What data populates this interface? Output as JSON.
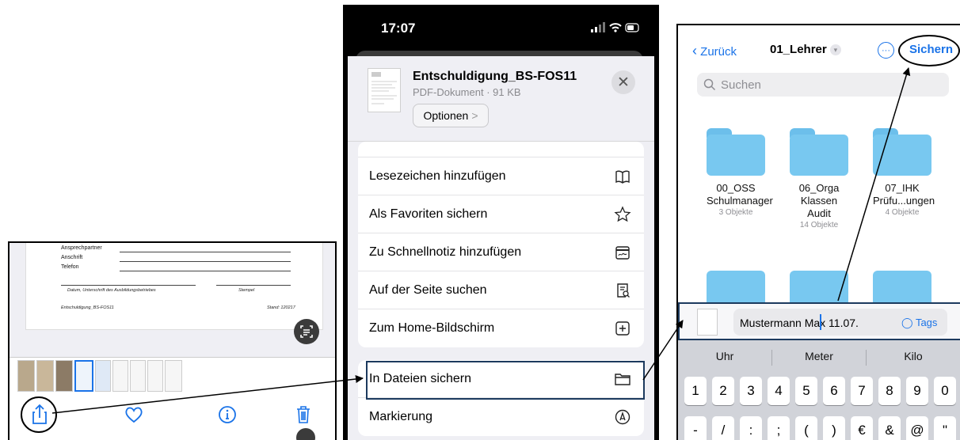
{
  "photos_panel": {
    "doc_labels": [
      "Ansprechpartner",
      "Anschrift",
      "Telefon"
    ],
    "doc_sign_caption": "Datum, Unterschrift des Ausbildungsbetriebes",
    "doc_stamp_caption": "Stempel",
    "doc_footer_left": "Entschuldigung_BS-FOS11",
    "doc_footer_right": "Stand: 120217",
    "toolbar": [
      "share-icon",
      "heart-icon",
      "info-icon",
      "trash-icon"
    ],
    "accent_color": "#1a73e8"
  },
  "share_sheet": {
    "time": "17:07",
    "file_name": "Entschuldigung_BS-FOS11",
    "file_meta": "PDF-Dokument · 91 KB",
    "options_label": "Optionen",
    "options_chevron": ">",
    "close_glyph": "✕",
    "actions_group1": [
      {
        "label": "Lesezeichen hinzufügen",
        "icon": "book-icon"
      },
      {
        "label": "Als Favoriten sichern",
        "icon": "star-icon"
      },
      {
        "label": "Zu Schnellnotiz hinzufügen",
        "icon": "quicknote-icon"
      },
      {
        "label": "Auf der Seite suchen",
        "icon": "find-on-page-icon"
      },
      {
        "label": "Zum Home-Bildschirm",
        "icon": "add-square-icon"
      }
    ],
    "actions_group2": [
      {
        "label": "In Dateien sichern",
        "icon": "folder-icon"
      },
      {
        "label": "Markierung",
        "icon": "markup-icon"
      }
    ]
  },
  "files_panel": {
    "back_label": "Zurück",
    "folder_title": "01_Lehrer",
    "save_label": "Sichern",
    "more_glyph": "···",
    "search_placeholder": "Suchen",
    "folders": [
      {
        "line1": "00_OSS",
        "line2": "Schulmanager",
        "count": "3 Objekte"
      },
      {
        "line1": "06_Orga",
        "line2": "Klassen Audit",
        "count": "14 Objekte"
      },
      {
        "line1": "07_IHK",
        "line2": "Prüfu...ungen",
        "count": "4 Objekte"
      }
    ],
    "filename_value": "Mustermann Max 11.07.",
    "tags_label": "Tags",
    "suggestions": [
      "Uhr",
      "Meter",
      "Kilo"
    ],
    "number_keys": [
      "1",
      "2",
      "3",
      "4",
      "5",
      "6",
      "7",
      "8",
      "9",
      "0"
    ],
    "symbol_keys": [
      "-",
      "/",
      ":",
      ";",
      "(",
      ")",
      "€",
      "&",
      "@",
      "\""
    ]
  }
}
